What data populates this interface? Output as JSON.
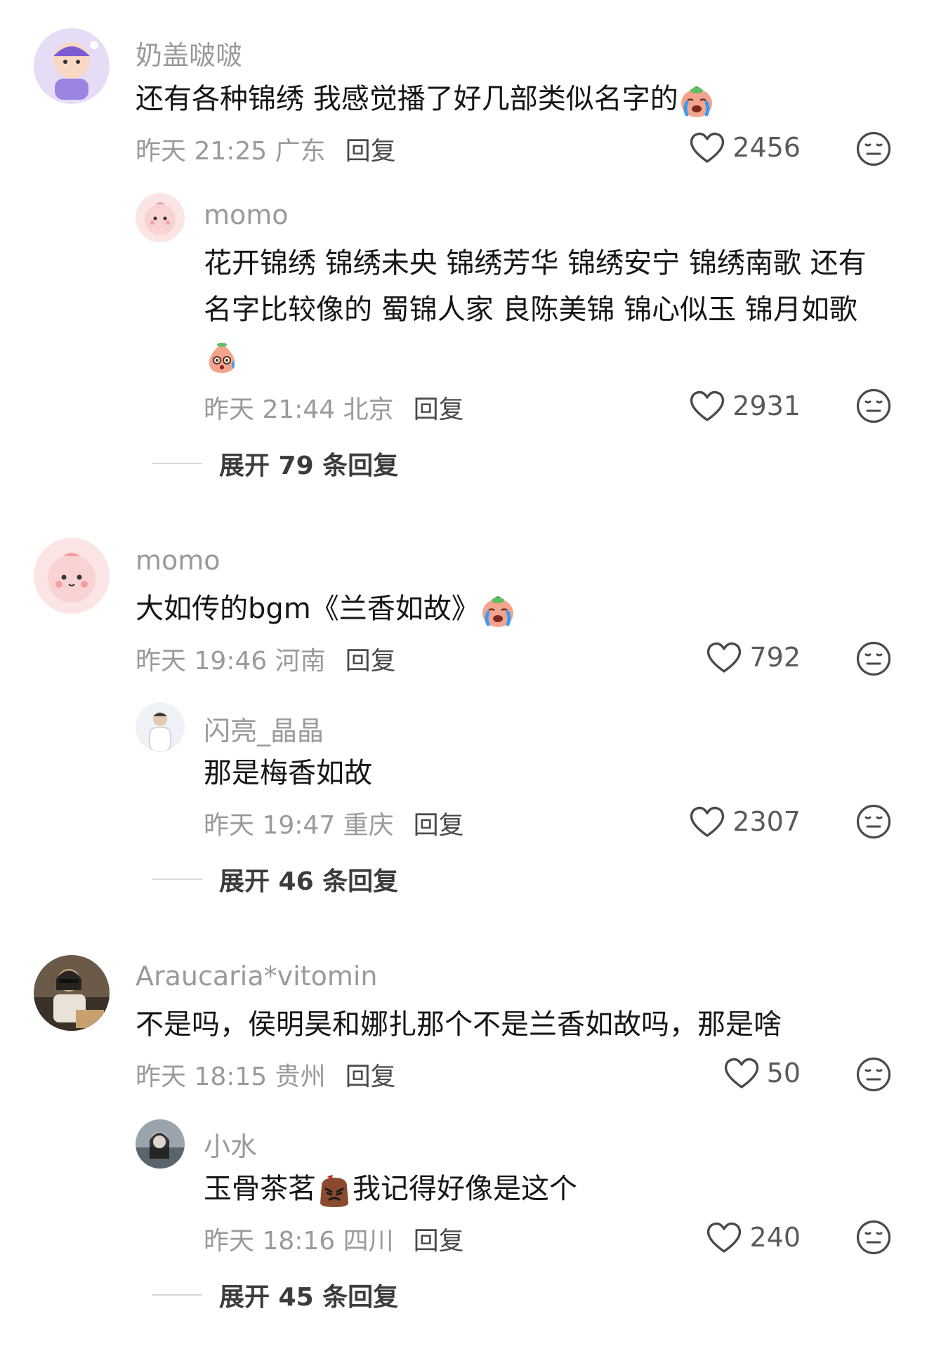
{
  "comments": [
    {
      "username": "奶盖啵啵",
      "text_before": "还有各种锦绣 我感觉播了好几部类似名字的",
      "emoji": "crying-face-emoji",
      "time": "昨天 21:25 广东",
      "reply": "回复",
      "likes": "2456",
      "replies": [
        {
          "username": "momo",
          "line1": "花开锦绣 锦绣未央 锦绣芳华 锦绣安宁 锦绣南歌 还有",
          "line2": "名字比较像的 蜀锦人家 良陈美锦 锦心似玉 锦月如歌",
          "emoji": "sweat-face-emoji",
          "time": "昨天 21:44 北京",
          "reply": "回复",
          "likes": "2931"
        }
      ],
      "expand": "展开 79 条回复"
    },
    {
      "username": "momo",
      "text_before": "大如传的bgm《兰香如故》",
      "emoji": "crying-face-emoji",
      "time": "昨天 19:46 河南",
      "reply": "回复",
      "likes": "792",
      "replies": [
        {
          "username": "闪亮_晶晶",
          "text": "那是梅香如故",
          "time": "昨天 19:47 重庆",
          "reply": "回复",
          "likes": "2307"
        }
      ],
      "expand": "展开 46 条回复"
    },
    {
      "username": "Araucaria*vitomin",
      "text": "不是吗，侯明昊和娜扎那个不是兰香如故吗，那是啥",
      "time": "昨天 18:15 贵州",
      "reply": "回复",
      "likes": "50",
      "replies": [
        {
          "username": "小水",
          "text_before": "玉骨茶茗",
          "emoji": "angry-face-emoji",
          "text_after": "我记得好像是这个",
          "time": "昨天 18:16 四川",
          "reply": "回复",
          "likes": "240"
        }
      ],
      "expand": "展开 45 条回复"
    }
  ],
  "icons": {
    "like": "heart-outline-icon",
    "dislike": "neutral-face-icon"
  },
  "colors": {
    "secondary_text": "#9a9a9a",
    "primary_text": "#161616",
    "icon": "#4a4a4a"
  }
}
